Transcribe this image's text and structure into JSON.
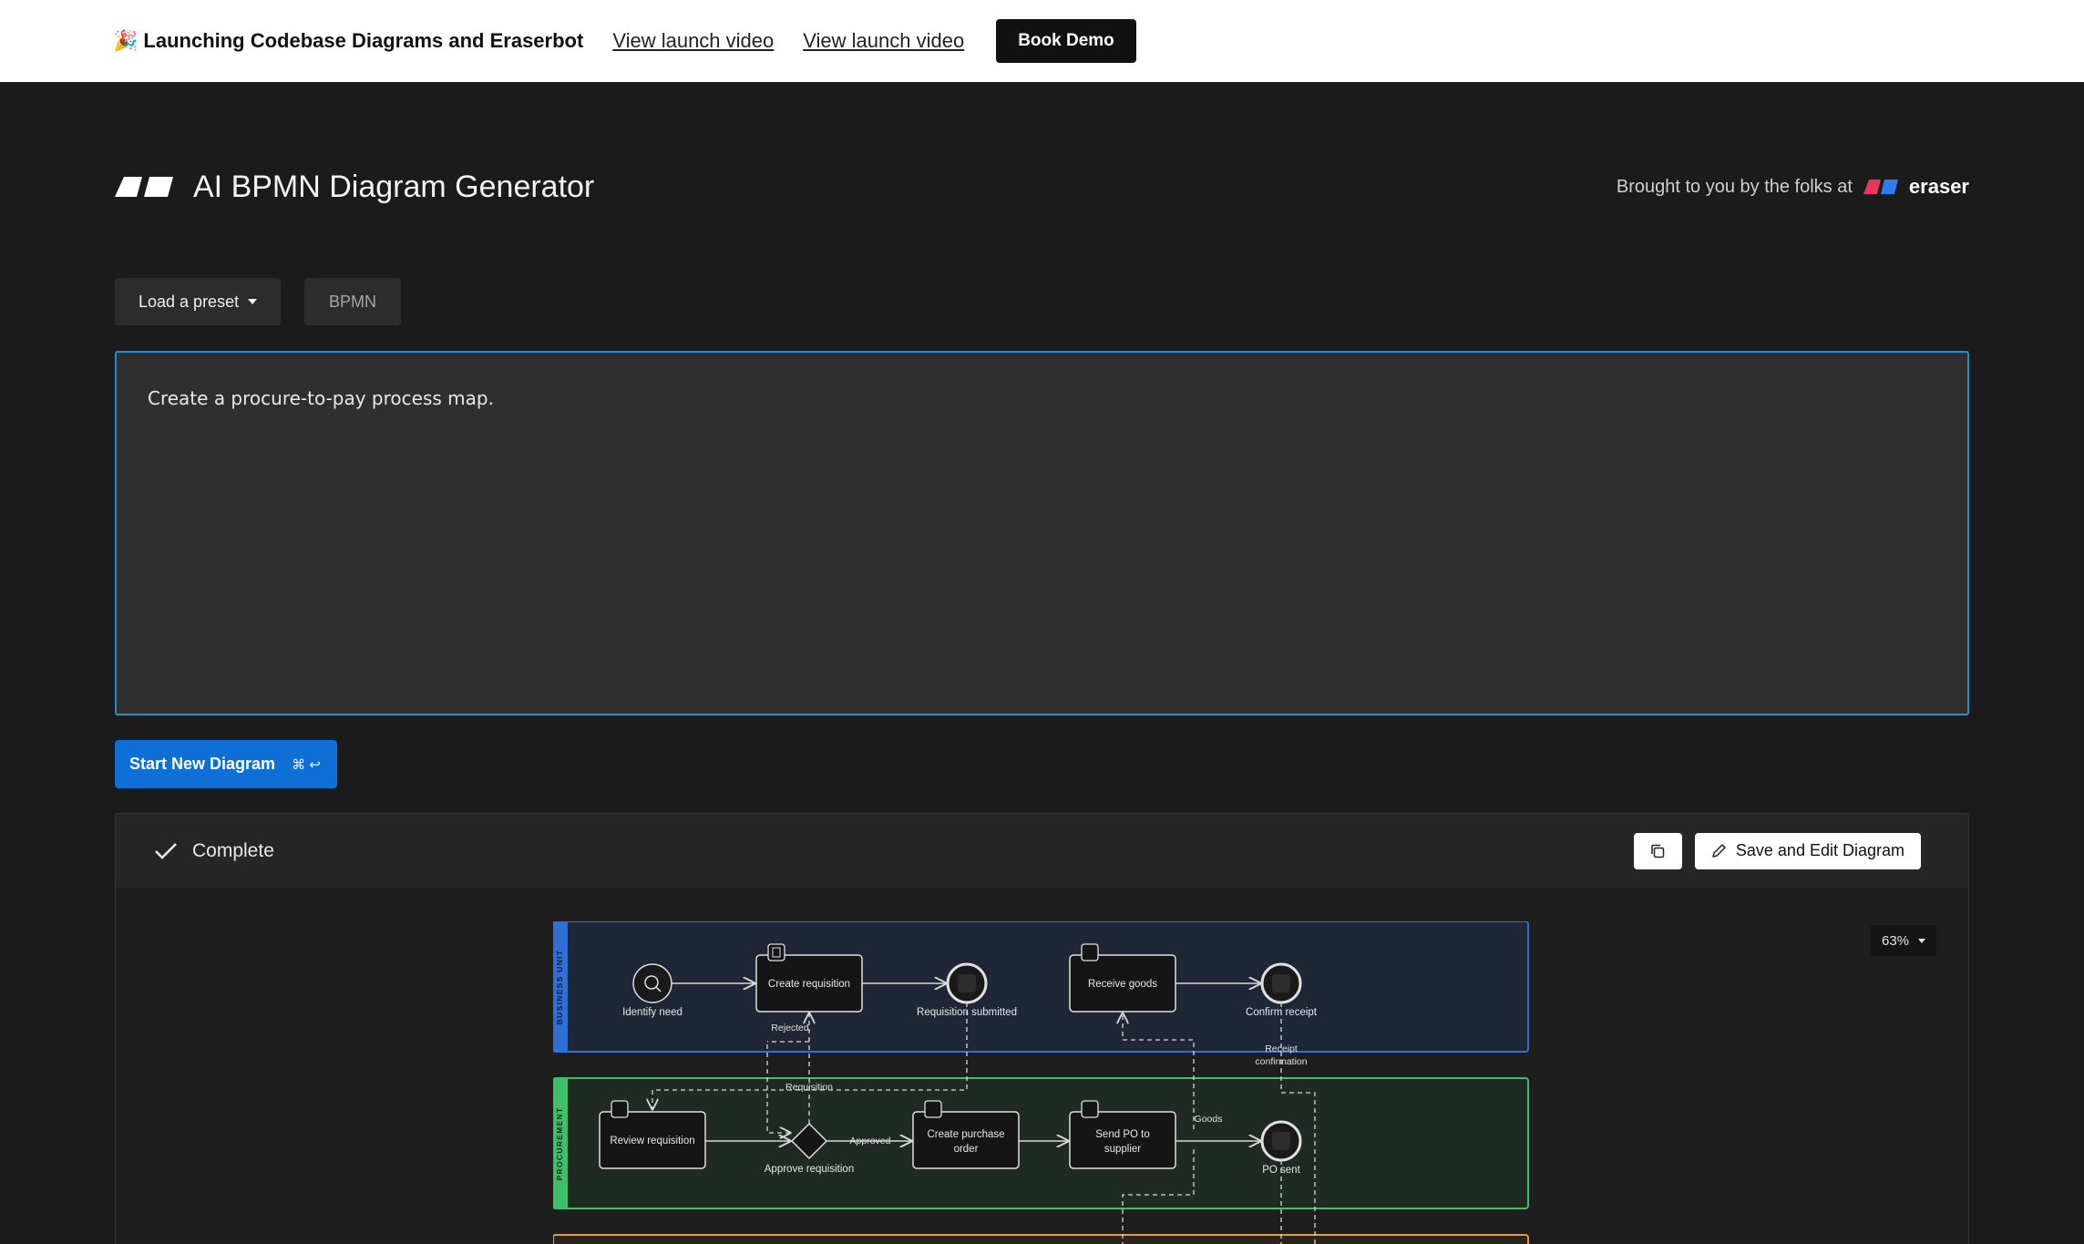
{
  "announcement": {
    "text": "Launching Codebase Diagrams and Eraserbot",
    "links": [
      "View launch video",
      "View launch video"
    ],
    "cta": "Book Demo"
  },
  "header": {
    "title": "AI BPMN Diagram Generator",
    "byline": "Brought to you by the folks at",
    "brand": "eraser"
  },
  "controls": {
    "preset_label": "Load a preset",
    "diagram_type": "BPMN"
  },
  "prompt": {
    "value": "Create a procure-to-pay process map."
  },
  "start_button": {
    "label": "Start New Diagram",
    "shortcut": "⌘ ↩"
  },
  "result": {
    "status": "Complete",
    "save_label": "Save and Edit Diagram",
    "zoom": "63%"
  },
  "diagram": {
    "lanes": [
      "BUSINESS UNIT",
      "PROCUREMENT"
    ],
    "nodes": {
      "identify_need": "Identify need",
      "create_requisition": "Create requisition",
      "requisition_submitted": "Requisition submitted",
      "receive_goods": "Receive goods",
      "confirm_receipt": "Confirm receipt",
      "review_requisition": "Review requisition",
      "approve_requisition": "Approve requisition",
      "create_po_1": "Create purchase",
      "create_po_2": "order",
      "send_po_1": "Send PO to",
      "send_po_2": "supplier",
      "po_sent": "PO sent"
    },
    "edges": {
      "rejected": "Rejected",
      "requisition": "Requisition",
      "approved": "Approved",
      "goods": "Goods",
      "receipt_confirmation_1": "Receipt",
      "receipt_confirmation_2": "confirmation"
    }
  },
  "colors": {
    "accent_blue": "#0e6fd6",
    "focus_border": "#1e8fc9",
    "lane_blue": "#2f6fd6",
    "lane_green": "#3fbf6a",
    "lane_orange": "#e89a3c"
  }
}
